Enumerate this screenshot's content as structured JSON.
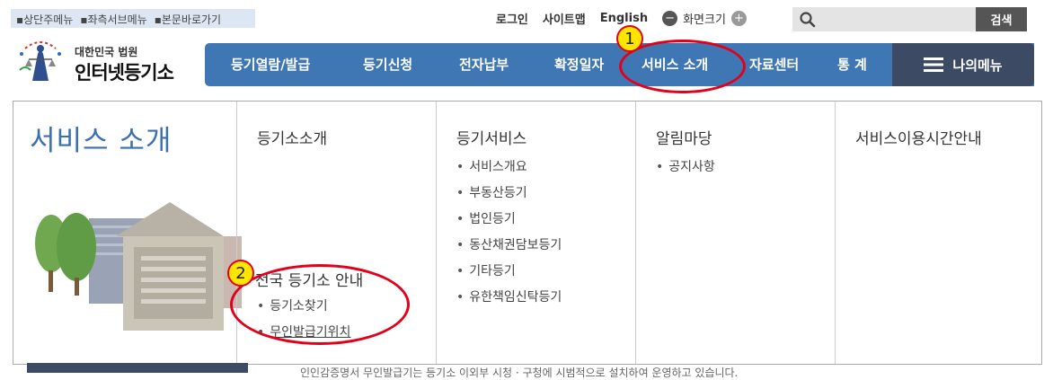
{
  "skip_links": [
    "▪상단주메뉴",
    "▪좌측서브메뉴",
    "▪본문바로가기"
  ],
  "util": {
    "login": "로그인",
    "sitemap": "사이트맵",
    "english": "English",
    "zoom_label": "화면크기",
    "zoom_minus": "−",
    "zoom_plus": "+"
  },
  "search": {
    "placeholder": "",
    "button": "검색"
  },
  "logo": {
    "line1": "대한민국 법원",
    "line2": "인터넷등기소"
  },
  "gnb": [
    "등기열람/발급",
    "등기신청",
    "전자납부",
    "확정일자",
    "서비스 소개",
    "자료센터",
    "통 계"
  ],
  "my_menu": "나의메뉴",
  "mega": {
    "title": "서비스 소개",
    "col1": {
      "heading": "등기소소개",
      "sub_heading": "전국 등기소 안내",
      "items": [
        "등기소찾기",
        "무인발급기위치"
      ]
    },
    "col2": {
      "heading": "등기서비스",
      "items": [
        "서비스개요",
        "부동산등기",
        "법인등기",
        "동산채권담보등기",
        "기타등기",
        "유한책임신탁등기"
      ]
    },
    "col3": {
      "heading": "알림마당",
      "items": [
        "공지사항"
      ]
    },
    "col4": {
      "heading": "서비스이용시간안내"
    }
  },
  "badges": [
    "1",
    "2"
  ],
  "colors": {
    "nav": "#3f76b4",
    "my_menu": "#3c4a63",
    "title": "#3b6fae",
    "annotation": "#e3001a",
    "badge": "#ffe600"
  },
  "below": {
    "text": "인인감증명서 무인발급기는 등기소 이외부 시청 · 구청에 시범적으로 설치하여 운영하고 있습니다."
  }
}
